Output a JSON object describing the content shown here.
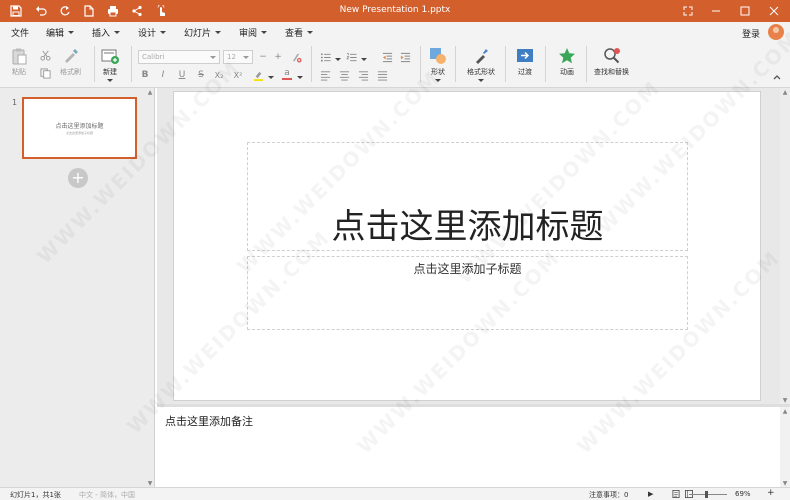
{
  "titlebar": {
    "title": "New Presentation 1.pptx",
    "color": "#d35f2d"
  },
  "menu": {
    "items": [
      {
        "label": "文件",
        "caret": false
      },
      {
        "label": "编辑",
        "caret": true
      },
      {
        "label": "插入",
        "caret": true
      },
      {
        "label": "设计",
        "caret": true
      },
      {
        "label": "幻灯片",
        "caret": true
      },
      {
        "label": "审阅",
        "caret": true
      },
      {
        "label": "查看",
        "caret": true
      }
    ],
    "login": "登录"
  },
  "ribbon": {
    "paste": "粘贴",
    "format_painter": "格式刷",
    "new_slide": "新建",
    "font_name": "Calibri",
    "font_size": "12",
    "shape": "形状",
    "format_shape": "格式形状",
    "transition": "过渡",
    "animation": "动画",
    "find_replace": "查找和替换",
    "buttons": {
      "bold": "B",
      "italic": "I",
      "underline": "U",
      "strike": "S",
      "subscript": "X₂",
      "superscript": "X²",
      "font_color": "a"
    }
  },
  "slides_pane": {
    "slide_number": "1",
    "thumb_title": "点击这里添加标题",
    "thumb_subtitle": "点击这里添加子标题"
  },
  "slide": {
    "title_placeholder": "点击这里添加标题",
    "subtitle_placeholder": "点击这里添加子标题"
  },
  "notes": {
    "placeholder": "点击这里添加备注"
  },
  "status": {
    "slide_info": "幻灯片1，共1张",
    "language": "中文 - 简体，中国",
    "notes_label": "注意事项：0",
    "zoom": "69%",
    "zoom_minus": "−",
    "zoom_plus": "+"
  },
  "watermark": "WWW.WEIDOWN.COM"
}
